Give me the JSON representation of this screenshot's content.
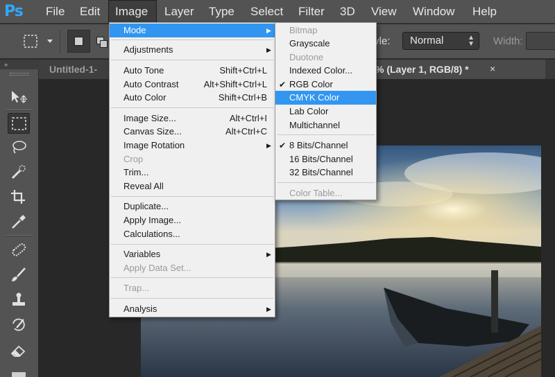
{
  "app": {
    "logo": "Ps"
  },
  "menubar": {
    "items": [
      "File",
      "Edit",
      "Image",
      "Layer",
      "Type",
      "Select",
      "Filter",
      "3D",
      "View",
      "Window",
      "Help"
    ],
    "active": "Image"
  },
  "options": {
    "style_label": "tyle:",
    "style_value": "Normal",
    "width_label": "Width:"
  },
  "tabs": {
    "left": "Untitled-1-",
    "right": "% (Layer 1, RGB/8) *",
    "close": "×"
  },
  "toolbar": {
    "header": "»"
  },
  "image_menu": {
    "items": [
      {
        "label": "Mode",
        "shortcut": "",
        "submenu": true,
        "highlight": true,
        "disabled": false
      },
      {
        "label": "Adjustments",
        "shortcut": "",
        "submenu": true,
        "highlight": false,
        "disabled": false
      },
      {
        "label": "Auto Tone",
        "shortcut": "Shift+Ctrl+L",
        "submenu": false,
        "highlight": false,
        "disabled": false
      },
      {
        "label": "Auto Contrast",
        "shortcut": "Alt+Shift+Ctrl+L",
        "submenu": false,
        "highlight": false,
        "disabled": false
      },
      {
        "label": "Auto Color",
        "shortcut": "Shift+Ctrl+B",
        "submenu": false,
        "highlight": false,
        "disabled": false
      },
      {
        "label": "Image Size...",
        "shortcut": "Alt+Ctrl+I",
        "submenu": false,
        "highlight": false,
        "disabled": false
      },
      {
        "label": "Canvas Size...",
        "shortcut": "Alt+Ctrl+C",
        "submenu": false,
        "highlight": false,
        "disabled": false
      },
      {
        "label": "Image Rotation",
        "shortcut": "",
        "submenu": true,
        "highlight": false,
        "disabled": false
      },
      {
        "label": "Crop",
        "shortcut": "",
        "submenu": false,
        "highlight": false,
        "disabled": true
      },
      {
        "label": "Trim...",
        "shortcut": "",
        "submenu": false,
        "highlight": false,
        "disabled": false
      },
      {
        "label": "Reveal All",
        "shortcut": "",
        "submenu": false,
        "highlight": false,
        "disabled": false
      },
      {
        "label": "Duplicate...",
        "shortcut": "",
        "submenu": false,
        "highlight": false,
        "disabled": false
      },
      {
        "label": "Apply Image...",
        "shortcut": "",
        "submenu": false,
        "highlight": false,
        "disabled": false
      },
      {
        "label": "Calculations...",
        "shortcut": "",
        "submenu": false,
        "highlight": false,
        "disabled": false
      },
      {
        "label": "Variables",
        "shortcut": "",
        "submenu": true,
        "highlight": false,
        "disabled": false
      },
      {
        "label": "Apply Data Set...",
        "shortcut": "",
        "submenu": false,
        "highlight": false,
        "disabled": true
      },
      {
        "label": "Trap...",
        "shortcut": "",
        "submenu": false,
        "highlight": false,
        "disabled": true
      },
      {
        "label": "Analysis",
        "shortcut": "",
        "submenu": true,
        "highlight": false,
        "disabled": false
      }
    ]
  },
  "mode_menu": {
    "items": [
      {
        "label": "Bitmap",
        "checked": false,
        "highlight": false,
        "disabled": true
      },
      {
        "label": "Grayscale",
        "checked": false,
        "highlight": false,
        "disabled": false
      },
      {
        "label": "Duotone",
        "checked": false,
        "highlight": false,
        "disabled": true
      },
      {
        "label": "Indexed Color...",
        "checked": false,
        "highlight": false,
        "disabled": false
      },
      {
        "label": "RGB Color",
        "checked": true,
        "highlight": false,
        "disabled": false
      },
      {
        "label": "CMYK Color",
        "checked": false,
        "highlight": true,
        "disabled": false
      },
      {
        "label": "Lab Color",
        "checked": false,
        "highlight": false,
        "disabled": false
      },
      {
        "label": "Multichannel",
        "checked": false,
        "highlight": false,
        "disabled": false
      },
      {
        "label": "8 Bits/Channel",
        "checked": true,
        "highlight": false,
        "disabled": false
      },
      {
        "label": "16 Bits/Channel",
        "checked": false,
        "highlight": false,
        "disabled": false
      },
      {
        "label": "32 Bits/Channel",
        "checked": false,
        "highlight": false,
        "disabled": false
      },
      {
        "label": "Color Table...",
        "checked": false,
        "highlight": false,
        "disabled": true
      }
    ]
  },
  "colors": {
    "menu_highlight": "#3296f0",
    "ui_panel": "#535353",
    "ps_blue": "#31a8ff"
  }
}
